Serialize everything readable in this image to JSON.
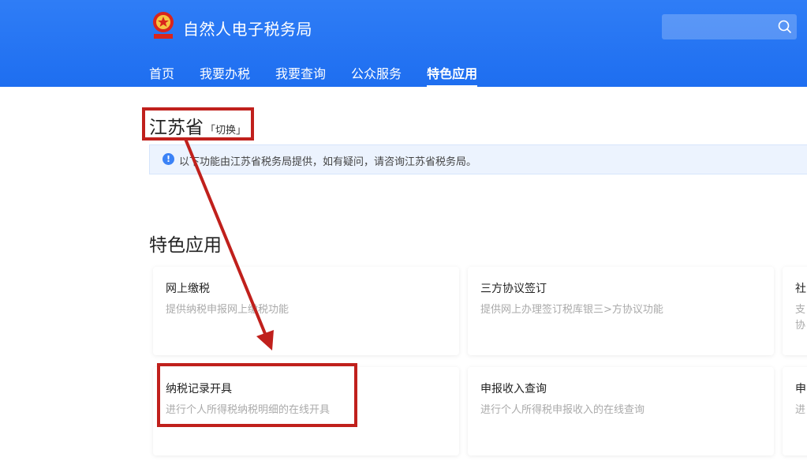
{
  "header": {
    "brand": "自然人电子税务局",
    "search_placeholder": "",
    "nav": [
      "首页",
      "我要办税",
      "我要查询",
      "公众服务",
      "特色应用"
    ],
    "active_nav": "特色应用"
  },
  "province": {
    "name": "江苏省",
    "switch_label": "「切换」"
  },
  "notice": "以下功能由江苏省税务局提供，如有疑问，请咨询江苏省税务局。",
  "section_title": "特色应用",
  "cards": [
    {
      "title": "网上缴税",
      "desc": "提供纳税申报网上缴税功能"
    },
    {
      "title": "三方协议签订",
      "desc": "提供网上办理签订税库银三>方协议功能"
    },
    {
      "title": "社",
      "desc": "支",
      "desc2": "协"
    },
    {
      "title": "纳税记录开具",
      "desc": "进行个人所得税纳税明细的在线开具"
    },
    {
      "title": "申报收入查询",
      "desc": "进行个人所得税申报收入的在线查询"
    },
    {
      "title": "申",
      "desc": "进"
    }
  ],
  "colors": {
    "header": "#1e6ef0",
    "annotation": "#c0201c",
    "notice_bg": "#ecf3fe"
  }
}
